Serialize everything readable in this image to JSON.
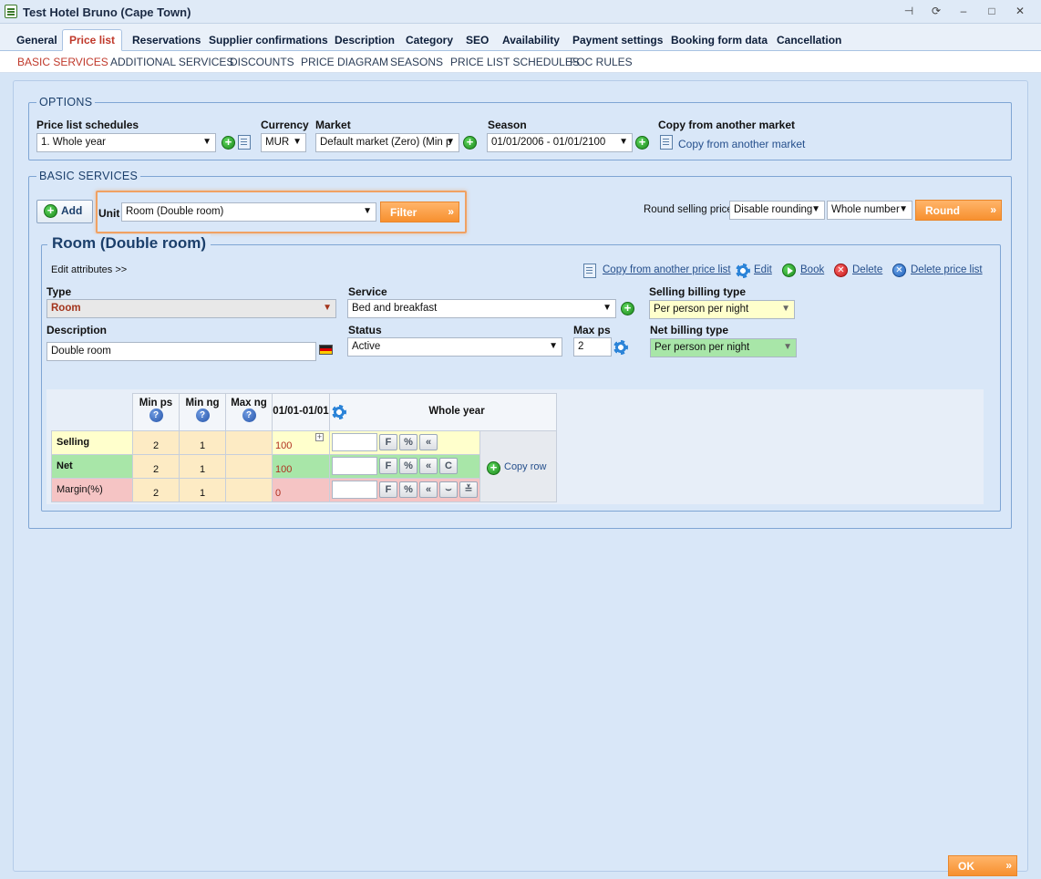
{
  "window": {
    "title": "Test Hotel Bruno (Cape Town)"
  },
  "tabs": [
    "General",
    "Price list",
    "Reservations",
    "Supplier confirmations",
    "Description",
    "Category",
    "SEO",
    "Availability",
    "Payment settings",
    "Booking form data",
    "Cancellation"
  ],
  "active_tab": "Price list",
  "subtabs": [
    "BASIC SERVICES",
    "ADDITIONAL SERVICES",
    "DISCOUNTS",
    "PRICE DIAGRAM",
    "SEASONS",
    "PRICE LIST SCHEDULES",
    "FOC RULES"
  ],
  "options": {
    "legend": "OPTIONS",
    "schedule_label": "Price list schedules",
    "schedule_value": "1. Whole year",
    "currency_label": "Currency",
    "currency_value": "MUR",
    "market_label": "Market",
    "market_value": "Default market (Zero) (Min p",
    "season_label": "Season",
    "season_value": "01/01/2006 - 01/01/2100",
    "copy_label": "Copy from another market",
    "copy_link": "Copy from another market"
  },
  "basic": {
    "legend": "BASIC SERVICES",
    "add_label": "Add",
    "unit_label": "Unit",
    "unit_value": "Room (Double room)",
    "filter_label": "Filter",
    "round_label": "Round selling price",
    "rounding_value": "Disable rounding",
    "number_value": "Whole number",
    "round_btn": "Round"
  },
  "room": {
    "title": "Room (Double room)",
    "edit_attributes": "Edit attributes >>",
    "actions": {
      "copy": "Copy from another price list",
      "edit": "Edit",
      "book": "Book",
      "delete": "Delete",
      "delete_list": "Delete price list"
    },
    "type_label": "Type",
    "type_value": "Room",
    "service_label": "Service",
    "service_value": "Bed and breakfast",
    "selling_billing_label": "Selling billing type",
    "selling_billing_value": "Per person per night",
    "description_label": "Description",
    "description_value": "Double room",
    "status_label": "Status",
    "status_value": "Active",
    "maxps_label": "Max ps",
    "maxps_value": "2",
    "net_billing_label": "Net billing type",
    "net_billing_value": "Per person per night"
  },
  "grid": {
    "headers": {
      "min_ps": "Min ps",
      "min_ng": "Min ng",
      "max_ng": "Max ng",
      "date": "01/01-01/01",
      "period": "Whole year"
    },
    "rows": [
      {
        "label": "Selling",
        "min_ps": "2",
        "min_ng": "1",
        "max_ng": "",
        "value": "100"
      },
      {
        "label": "Net",
        "min_ps": "2",
        "min_ng": "1",
        "max_ng": "",
        "value": "100"
      },
      {
        "label": "Margin(%)",
        "min_ps": "2",
        "min_ng": "1",
        "max_ng": "",
        "value": "0"
      }
    ],
    "copy_row": "Copy row",
    "btn_f": "F",
    "btn_pct": "%",
    "btn_back": "«",
    "btn_c": "C"
  },
  "footer": {
    "ok": "OK"
  }
}
